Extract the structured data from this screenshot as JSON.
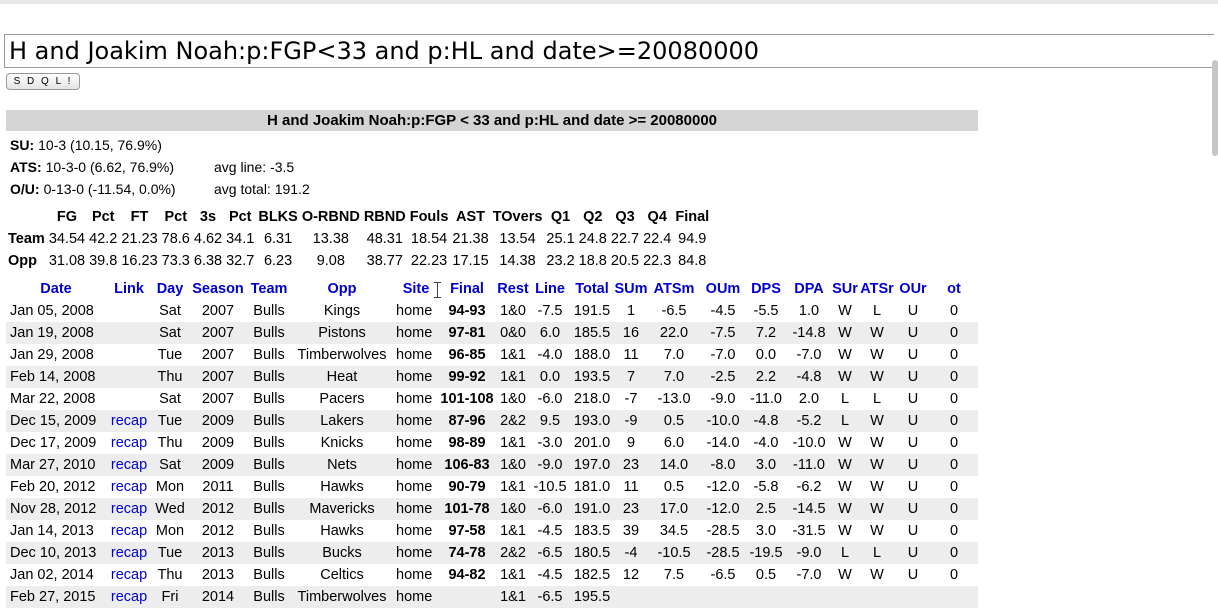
{
  "query": {
    "value": "H and Joakim Noah:p:FGP<33 and p:HL and date>=20080000"
  },
  "submit_label": "S D Q L !",
  "result_title": "H and Joakim Noah:p:FGP < 33 and p:HL and date >= 20080000",
  "summary": {
    "su": {
      "label": "SU:",
      "value": "10-3 (10.15, 76.9%)"
    },
    "ats": {
      "label": "ATS:",
      "value": "10-3-0 (6.62, 76.9%)",
      "avg": "avg line: -3.5"
    },
    "ou": {
      "label": "O/U:",
      "value": "0-13-0 (-11.54, 0.0%)",
      "avg": "avg total: 191.2"
    }
  },
  "stats": {
    "headers": [
      "",
      "FG",
      "Pct",
      "FT",
      "Pct",
      "3s",
      "Pct",
      "BLKS",
      "O-RBND",
      "RBND",
      "Fouls",
      "AST",
      "TOvers",
      "Q1",
      "Q2",
      "Q3",
      "Q4",
      "Final"
    ],
    "rows": [
      [
        "Team",
        "34.54",
        "42.2",
        "21.23",
        "78.6",
        "4.62",
        "34.1",
        "6.31",
        "13.38",
        "48.31",
        "18.54",
        "21.38",
        "13.54",
        "25.1",
        "24.8",
        "22.7",
        "22.4",
        "94.9"
      ],
      [
        "Opp",
        "31.08",
        "39.8",
        "16.23",
        "73.3",
        "6.38",
        "32.7",
        "6.23",
        "9.08",
        "38.77",
        "22.23",
        "17.15",
        "14.38",
        "23.2",
        "18.8",
        "20.5",
        "22.3",
        "84.8"
      ]
    ]
  },
  "games": {
    "headers": [
      "Date",
      "Link",
      "Day",
      "Season",
      "Team",
      "Opp",
      "Site",
      "Final",
      "Rest",
      "Line",
      "Total",
      "SUm",
      "ATSm",
      "OUm",
      "DPS",
      "DPA",
      "SUr",
      "ATSr",
      "OUr",
      "ot"
    ],
    "rows": [
      [
        "Jan 05, 2008",
        "",
        "Sat",
        "2007",
        "Bulls",
        "Kings",
        "home",
        "94-93",
        "1&0",
        "-7.5",
        "191.5",
        "1",
        "-6.5",
        "-4.5",
        "-5.5",
        "1.0",
        "W",
        "L",
        "U",
        "0"
      ],
      [
        "Jan 19, 2008",
        "",
        "Sat",
        "2007",
        "Bulls",
        "Pistons",
        "home",
        "97-81",
        "0&0",
        "6.0",
        "185.5",
        "16",
        "22.0",
        "-7.5",
        "7.2",
        "-14.8",
        "W",
        "W",
        "U",
        "0"
      ],
      [
        "Jan 29, 2008",
        "",
        "Tue",
        "2007",
        "Bulls",
        "Timberwolves",
        "home",
        "96-85",
        "1&1",
        "-4.0",
        "188.0",
        "11",
        "7.0",
        "-7.0",
        "0.0",
        "-7.0",
        "W",
        "W",
        "U",
        "0"
      ],
      [
        "Feb 14, 2008",
        "",
        "Thu",
        "2007",
        "Bulls",
        "Heat",
        "home",
        "99-92",
        "1&1",
        "0.0",
        "193.5",
        "7",
        "7.0",
        "-2.5",
        "2.2",
        "-4.8",
        "W",
        "W",
        "U",
        "0"
      ],
      [
        "Mar 22, 2008",
        "",
        "Sat",
        "2007",
        "Bulls",
        "Pacers",
        "home",
        "101-108",
        "1&0",
        "-6.0",
        "218.0",
        "-7",
        "-13.0",
        "-9.0",
        "-11.0",
        "2.0",
        "L",
        "L",
        "U",
        "0"
      ],
      [
        "Dec 15, 2009",
        "recap",
        "Tue",
        "2009",
        "Bulls",
        "Lakers",
        "home",
        "87-96",
        "2&2",
        "9.5",
        "193.0",
        "-9",
        "0.5",
        "-10.0",
        "-4.8",
        "-5.2",
        "L",
        "W",
        "U",
        "0"
      ],
      [
        "Dec 17, 2009",
        "recap",
        "Thu",
        "2009",
        "Bulls",
        "Knicks",
        "home",
        "98-89",
        "1&1",
        "-3.0",
        "201.0",
        "9",
        "6.0",
        "-14.0",
        "-4.0",
        "-10.0",
        "W",
        "W",
        "U",
        "0"
      ],
      [
        "Mar 27, 2010",
        "recap",
        "Sat",
        "2009",
        "Bulls",
        "Nets",
        "home",
        "106-83",
        "1&0",
        "-9.0",
        "197.0",
        "23",
        "14.0",
        "-8.0",
        "3.0",
        "-11.0",
        "W",
        "W",
        "U",
        "0"
      ],
      [
        "Feb 20, 2012",
        "recap",
        "Mon",
        "2011",
        "Bulls",
        "Hawks",
        "home",
        "90-79",
        "1&1",
        "-10.5",
        "181.0",
        "11",
        "0.5",
        "-12.0",
        "-5.8",
        "-6.2",
        "W",
        "W",
        "U",
        "0"
      ],
      [
        "Nov 28, 2012",
        "recap",
        "Wed",
        "2012",
        "Bulls",
        "Mavericks",
        "home",
        "101-78",
        "1&0",
        "-6.0",
        "191.0",
        "23",
        "17.0",
        "-12.0",
        "2.5",
        "-14.5",
        "W",
        "W",
        "U",
        "0"
      ],
      [
        "Jan 14, 2013",
        "recap",
        "Mon",
        "2012",
        "Bulls",
        "Hawks",
        "home",
        "97-58",
        "1&1",
        "-4.5",
        "183.5",
        "39",
        "34.5",
        "-28.5",
        "3.0",
        "-31.5",
        "W",
        "W",
        "U",
        "0"
      ],
      [
        "Dec 10, 2013",
        "recap",
        "Tue",
        "2013",
        "Bulls",
        "Bucks",
        "home",
        "74-78",
        "2&2",
        "-6.5",
        "180.5",
        "-4",
        "-10.5",
        "-28.5",
        "-19.5",
        "-9.0",
        "L",
        "L",
        "U",
        "0"
      ],
      [
        "Jan 02, 2014",
        "recap",
        "Thu",
        "2013",
        "Bulls",
        "Celtics",
        "home",
        "94-82",
        "1&1",
        "-4.5",
        "182.5",
        "12",
        "7.5",
        "-6.5",
        "0.5",
        "-7.0",
        "W",
        "W",
        "U",
        "0"
      ],
      [
        "Feb 27, 2015",
        "recap",
        "Fri",
        "2014",
        "Bulls",
        "Timberwolves",
        "home",
        "",
        "1&1",
        "-6.5",
        "195.5",
        "",
        "",
        "",
        "",
        "",
        "",
        "",
        "",
        ""
      ]
    ]
  }
}
